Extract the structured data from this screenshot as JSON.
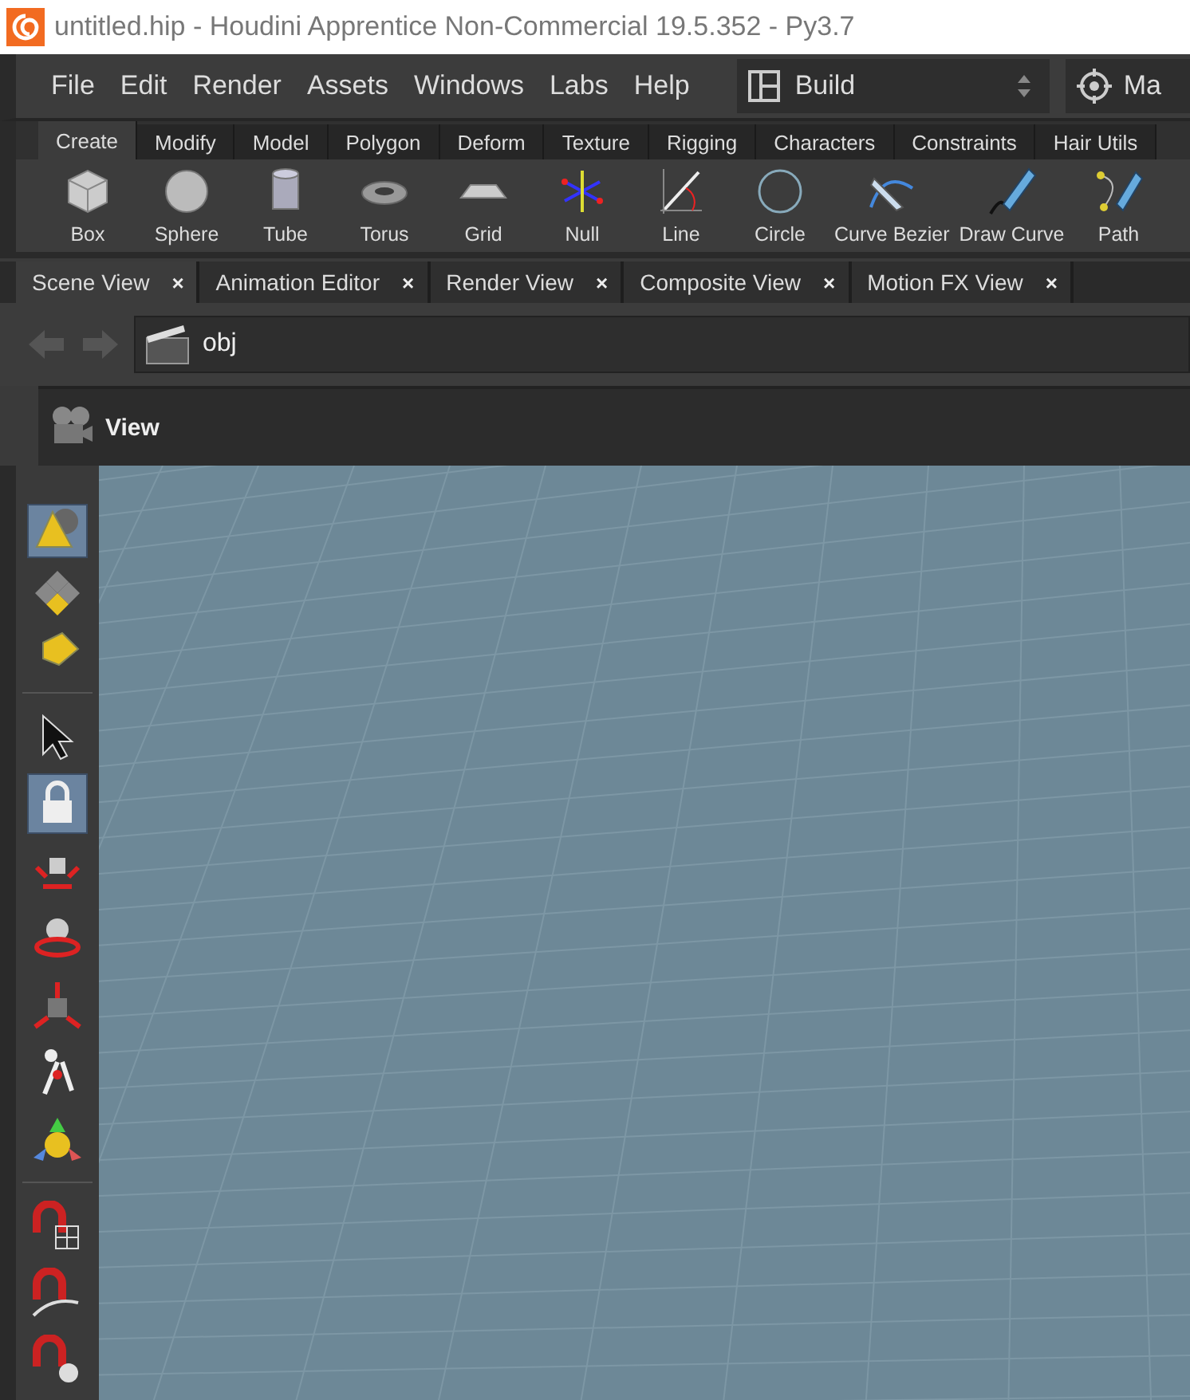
{
  "window": {
    "title": "untitled.hip - Houdini Apprentice Non-Commercial 19.5.352 - Py3.7"
  },
  "menu": [
    "File",
    "Edit",
    "Render",
    "Assets",
    "Windows",
    "Labs",
    "Help"
  ],
  "desktop": {
    "value": "Build"
  },
  "cut_button": {
    "label": "Ma"
  },
  "shelf_tabs": [
    {
      "label": "Create",
      "selected": true
    },
    {
      "label": "Modify",
      "selected": false
    },
    {
      "label": "Model",
      "selected": false
    },
    {
      "label": "Polygon",
      "selected": false
    },
    {
      "label": "Deform",
      "selected": false
    },
    {
      "label": "Texture",
      "selected": false
    },
    {
      "label": "Rigging",
      "selected": false
    },
    {
      "label": "Characters",
      "selected": false
    },
    {
      "label": "Constraints",
      "selected": false
    },
    {
      "label": "Hair Utils",
      "selected": false
    }
  ],
  "shelf_tools": [
    {
      "kind": "box",
      "label": "Box"
    },
    {
      "kind": "sphere",
      "label": "Sphere"
    },
    {
      "kind": "tube",
      "label": "Tube"
    },
    {
      "kind": "torus",
      "label": "Torus"
    },
    {
      "kind": "grid",
      "label": "Grid"
    },
    {
      "kind": "null",
      "label": "Null"
    },
    {
      "kind": "line",
      "label": "Line"
    },
    {
      "kind": "circle",
      "label": "Circle"
    },
    {
      "kind": "bezier",
      "label": "Curve Bezier"
    },
    {
      "kind": "pen",
      "label": "Draw Curve"
    },
    {
      "kind": "path",
      "label": "Path"
    }
  ],
  "pane_tabs": [
    {
      "label": "Scene View",
      "close": "×",
      "selected": true
    },
    {
      "label": "Animation Editor",
      "close": "×",
      "selected": false
    },
    {
      "label": "Render View",
      "close": "×",
      "selected": false
    },
    {
      "label": "Composite View",
      "close": "×",
      "selected": false
    },
    {
      "label": "Motion FX View",
      "close": "×",
      "selected": false
    }
  ],
  "path": {
    "value": "obj"
  },
  "view_header": {
    "label": "View"
  },
  "left_tools": [
    {
      "kind": "objects",
      "selected": true
    },
    {
      "kind": "components",
      "selected": false
    },
    {
      "kind": "geometry",
      "selected": false
    },
    {
      "kind": "select",
      "selected": false
    },
    {
      "kind": "lock",
      "selected": true
    },
    {
      "kind": "move",
      "selected": false
    },
    {
      "kind": "rotate",
      "selected": false
    },
    {
      "kind": "scale",
      "selected": false
    },
    {
      "kind": "pose",
      "selected": false
    },
    {
      "kind": "handle",
      "selected": false
    },
    {
      "kind": "snap-grid",
      "selected": false
    },
    {
      "kind": "snap-curve",
      "selected": false
    },
    {
      "kind": "snap-point",
      "selected": false
    }
  ]
}
